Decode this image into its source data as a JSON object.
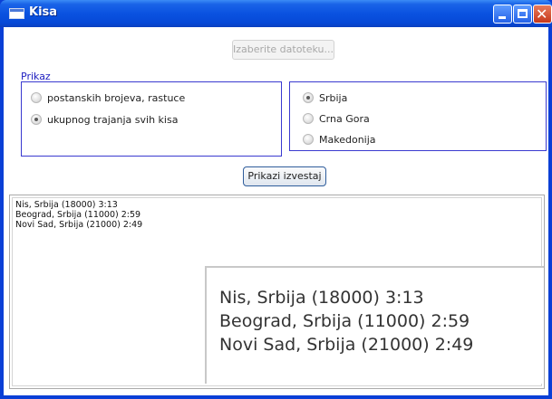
{
  "window": {
    "title": "Kisa"
  },
  "controls": {
    "choose_file_label": "Izaberite datoteku...",
    "show_report_label": "Prikazi izvestaj"
  },
  "group_label": "Prikaz",
  "sort_options": [
    {
      "label": "postanskih brojeva, rastuce",
      "checked": false
    },
    {
      "label": "ukupnog trajanja svih kisa",
      "checked": true
    }
  ],
  "countries": [
    {
      "label": "Srbija",
      "checked": true
    },
    {
      "label": "Crna Gora",
      "checked": false
    },
    {
      "label": "Makedonija",
      "checked": false
    }
  ],
  "output_lines": [
    "Nis, Srbija (18000) 3:13",
    "Beograd, Srbija (11000) 2:59",
    "Novi Sad, Srbija (21000) 2:49"
  ],
  "zoom_lines": [
    "Nis, Srbija (18000) 3:13",
    "Beograd, Srbija (11000) 2:59",
    "Novi Sad, Srbija (21000) 2:49"
  ]
}
